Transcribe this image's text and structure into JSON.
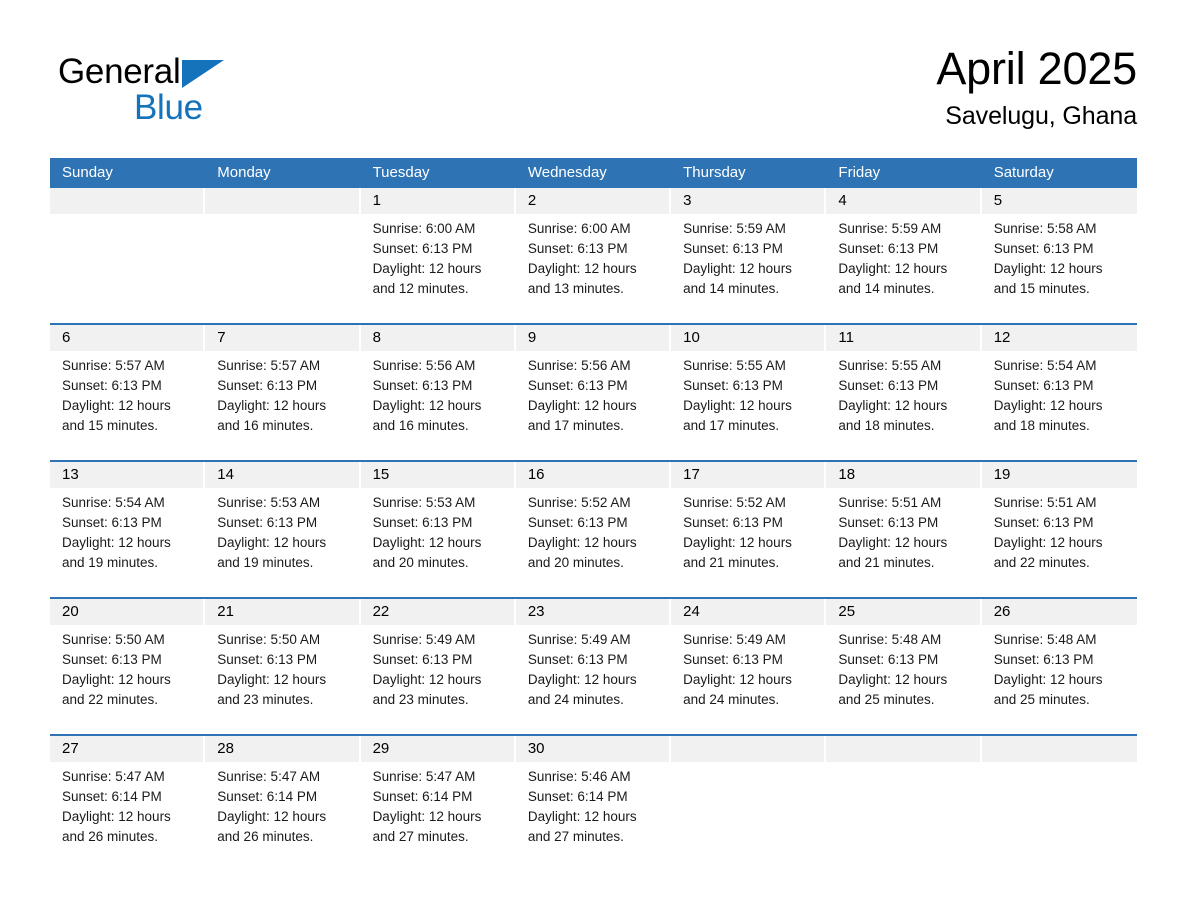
{
  "logo": {
    "text_black": "General",
    "text_blue": "Blue",
    "triangle_color": "#1573bb"
  },
  "header": {
    "month_title": "April 2025",
    "location": "Savelugu, Ghana"
  },
  "colors": {
    "header_blue": "#2e74b5",
    "day_band_gray": "#f1f1f1",
    "logo_blue": "#1573bb"
  },
  "calendar": {
    "weekdays": [
      "Sunday",
      "Monday",
      "Tuesday",
      "Wednesday",
      "Thursday",
      "Friday",
      "Saturday"
    ],
    "weeks": [
      [
        {
          "day": "",
          "info": ""
        },
        {
          "day": "",
          "info": ""
        },
        {
          "day": "1",
          "info": "Sunrise: 6:00 AM\nSunset: 6:13 PM\nDaylight: 12 hours\nand 12 minutes."
        },
        {
          "day": "2",
          "info": "Sunrise: 6:00 AM\nSunset: 6:13 PM\nDaylight: 12 hours\nand 13 minutes."
        },
        {
          "day": "3",
          "info": "Sunrise: 5:59 AM\nSunset: 6:13 PM\nDaylight: 12 hours\nand 14 minutes."
        },
        {
          "day": "4",
          "info": "Sunrise: 5:59 AM\nSunset: 6:13 PM\nDaylight: 12 hours\nand 14 minutes."
        },
        {
          "day": "5",
          "info": "Sunrise: 5:58 AM\nSunset: 6:13 PM\nDaylight: 12 hours\nand 15 minutes."
        }
      ],
      [
        {
          "day": "6",
          "info": "Sunrise: 5:57 AM\nSunset: 6:13 PM\nDaylight: 12 hours\nand 15 minutes."
        },
        {
          "day": "7",
          "info": "Sunrise: 5:57 AM\nSunset: 6:13 PM\nDaylight: 12 hours\nand 16 minutes."
        },
        {
          "day": "8",
          "info": "Sunrise: 5:56 AM\nSunset: 6:13 PM\nDaylight: 12 hours\nand 16 minutes."
        },
        {
          "day": "9",
          "info": "Sunrise: 5:56 AM\nSunset: 6:13 PM\nDaylight: 12 hours\nand 17 minutes."
        },
        {
          "day": "10",
          "info": "Sunrise: 5:55 AM\nSunset: 6:13 PM\nDaylight: 12 hours\nand 17 minutes."
        },
        {
          "day": "11",
          "info": "Sunrise: 5:55 AM\nSunset: 6:13 PM\nDaylight: 12 hours\nand 18 minutes."
        },
        {
          "day": "12",
          "info": "Sunrise: 5:54 AM\nSunset: 6:13 PM\nDaylight: 12 hours\nand 18 minutes."
        }
      ],
      [
        {
          "day": "13",
          "info": "Sunrise: 5:54 AM\nSunset: 6:13 PM\nDaylight: 12 hours\nand 19 minutes."
        },
        {
          "day": "14",
          "info": "Sunrise: 5:53 AM\nSunset: 6:13 PM\nDaylight: 12 hours\nand 19 minutes."
        },
        {
          "day": "15",
          "info": "Sunrise: 5:53 AM\nSunset: 6:13 PM\nDaylight: 12 hours\nand 20 minutes."
        },
        {
          "day": "16",
          "info": "Sunrise: 5:52 AM\nSunset: 6:13 PM\nDaylight: 12 hours\nand 20 minutes."
        },
        {
          "day": "17",
          "info": "Sunrise: 5:52 AM\nSunset: 6:13 PM\nDaylight: 12 hours\nand 21 minutes."
        },
        {
          "day": "18",
          "info": "Sunrise: 5:51 AM\nSunset: 6:13 PM\nDaylight: 12 hours\nand 21 minutes."
        },
        {
          "day": "19",
          "info": "Sunrise: 5:51 AM\nSunset: 6:13 PM\nDaylight: 12 hours\nand 22 minutes."
        }
      ],
      [
        {
          "day": "20",
          "info": "Sunrise: 5:50 AM\nSunset: 6:13 PM\nDaylight: 12 hours\nand 22 minutes."
        },
        {
          "day": "21",
          "info": "Sunrise: 5:50 AM\nSunset: 6:13 PM\nDaylight: 12 hours\nand 23 minutes."
        },
        {
          "day": "22",
          "info": "Sunrise: 5:49 AM\nSunset: 6:13 PM\nDaylight: 12 hours\nand 23 minutes."
        },
        {
          "day": "23",
          "info": "Sunrise: 5:49 AM\nSunset: 6:13 PM\nDaylight: 12 hours\nand 24 minutes."
        },
        {
          "day": "24",
          "info": "Sunrise: 5:49 AM\nSunset: 6:13 PM\nDaylight: 12 hours\nand 24 minutes."
        },
        {
          "day": "25",
          "info": "Sunrise: 5:48 AM\nSunset: 6:13 PM\nDaylight: 12 hours\nand 25 minutes."
        },
        {
          "day": "26",
          "info": "Sunrise: 5:48 AM\nSunset: 6:13 PM\nDaylight: 12 hours\nand 25 minutes."
        }
      ],
      [
        {
          "day": "27",
          "info": "Sunrise: 5:47 AM\nSunset: 6:14 PM\nDaylight: 12 hours\nand 26 minutes."
        },
        {
          "day": "28",
          "info": "Sunrise: 5:47 AM\nSunset: 6:14 PM\nDaylight: 12 hours\nand 26 minutes."
        },
        {
          "day": "29",
          "info": "Sunrise: 5:47 AM\nSunset: 6:14 PM\nDaylight: 12 hours\nand 27 minutes."
        },
        {
          "day": "30",
          "info": "Sunrise: 5:46 AM\nSunset: 6:14 PM\nDaylight: 12 hours\nand 27 minutes."
        },
        {
          "day": "",
          "info": ""
        },
        {
          "day": "",
          "info": ""
        },
        {
          "day": "",
          "info": ""
        }
      ]
    ]
  }
}
